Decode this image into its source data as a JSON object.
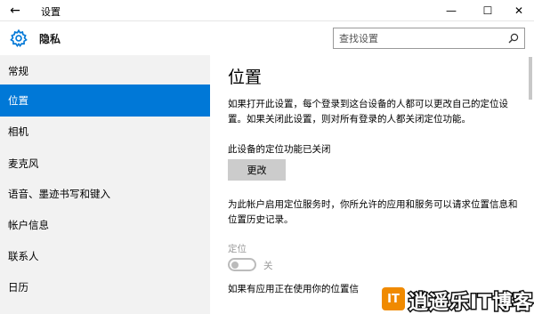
{
  "window": {
    "title": "设置",
    "back_icon": "←",
    "minimize_icon": "—",
    "maximize_icon": "☐",
    "close_icon": "✕"
  },
  "header": {
    "title": "隐私",
    "search_placeholder": "查找设置"
  },
  "sidebar": {
    "items": [
      {
        "label": "常规"
      },
      {
        "label": "位置",
        "active": true
      },
      {
        "label": "相机"
      },
      {
        "label": "麦克风"
      },
      {
        "label": "语音、墨迹书写和键入"
      },
      {
        "label": "帐户信息"
      },
      {
        "label": "联系人"
      },
      {
        "label": "日历"
      }
    ]
  },
  "main": {
    "title": "位置",
    "intro": "如果打开此设置，每个登录到这台设备的人都可以更改自己的定位设置。如果关闭此设置，则对所有登录的人都关闭定位功能。",
    "device_status": "此设备的定位功能已关闭",
    "change_button": "更改",
    "service_desc": "为此帐户启用定位服务时，你所允许的应用和服务可以请求位置信息和位置历史记录。",
    "location_label": "定位",
    "toggle_state": "关",
    "bottom_text": "如果有应用正在使用你的位置信"
  },
  "watermark": {
    "badge": "IT",
    "text": "逍遥乐IT博客"
  },
  "colors": {
    "accent": "#0078d7",
    "sidebar_bg": "#f2f2f2",
    "button_bg": "#cccccc",
    "disabled_text": "#999999",
    "watermark_orange": "#f08a00"
  }
}
